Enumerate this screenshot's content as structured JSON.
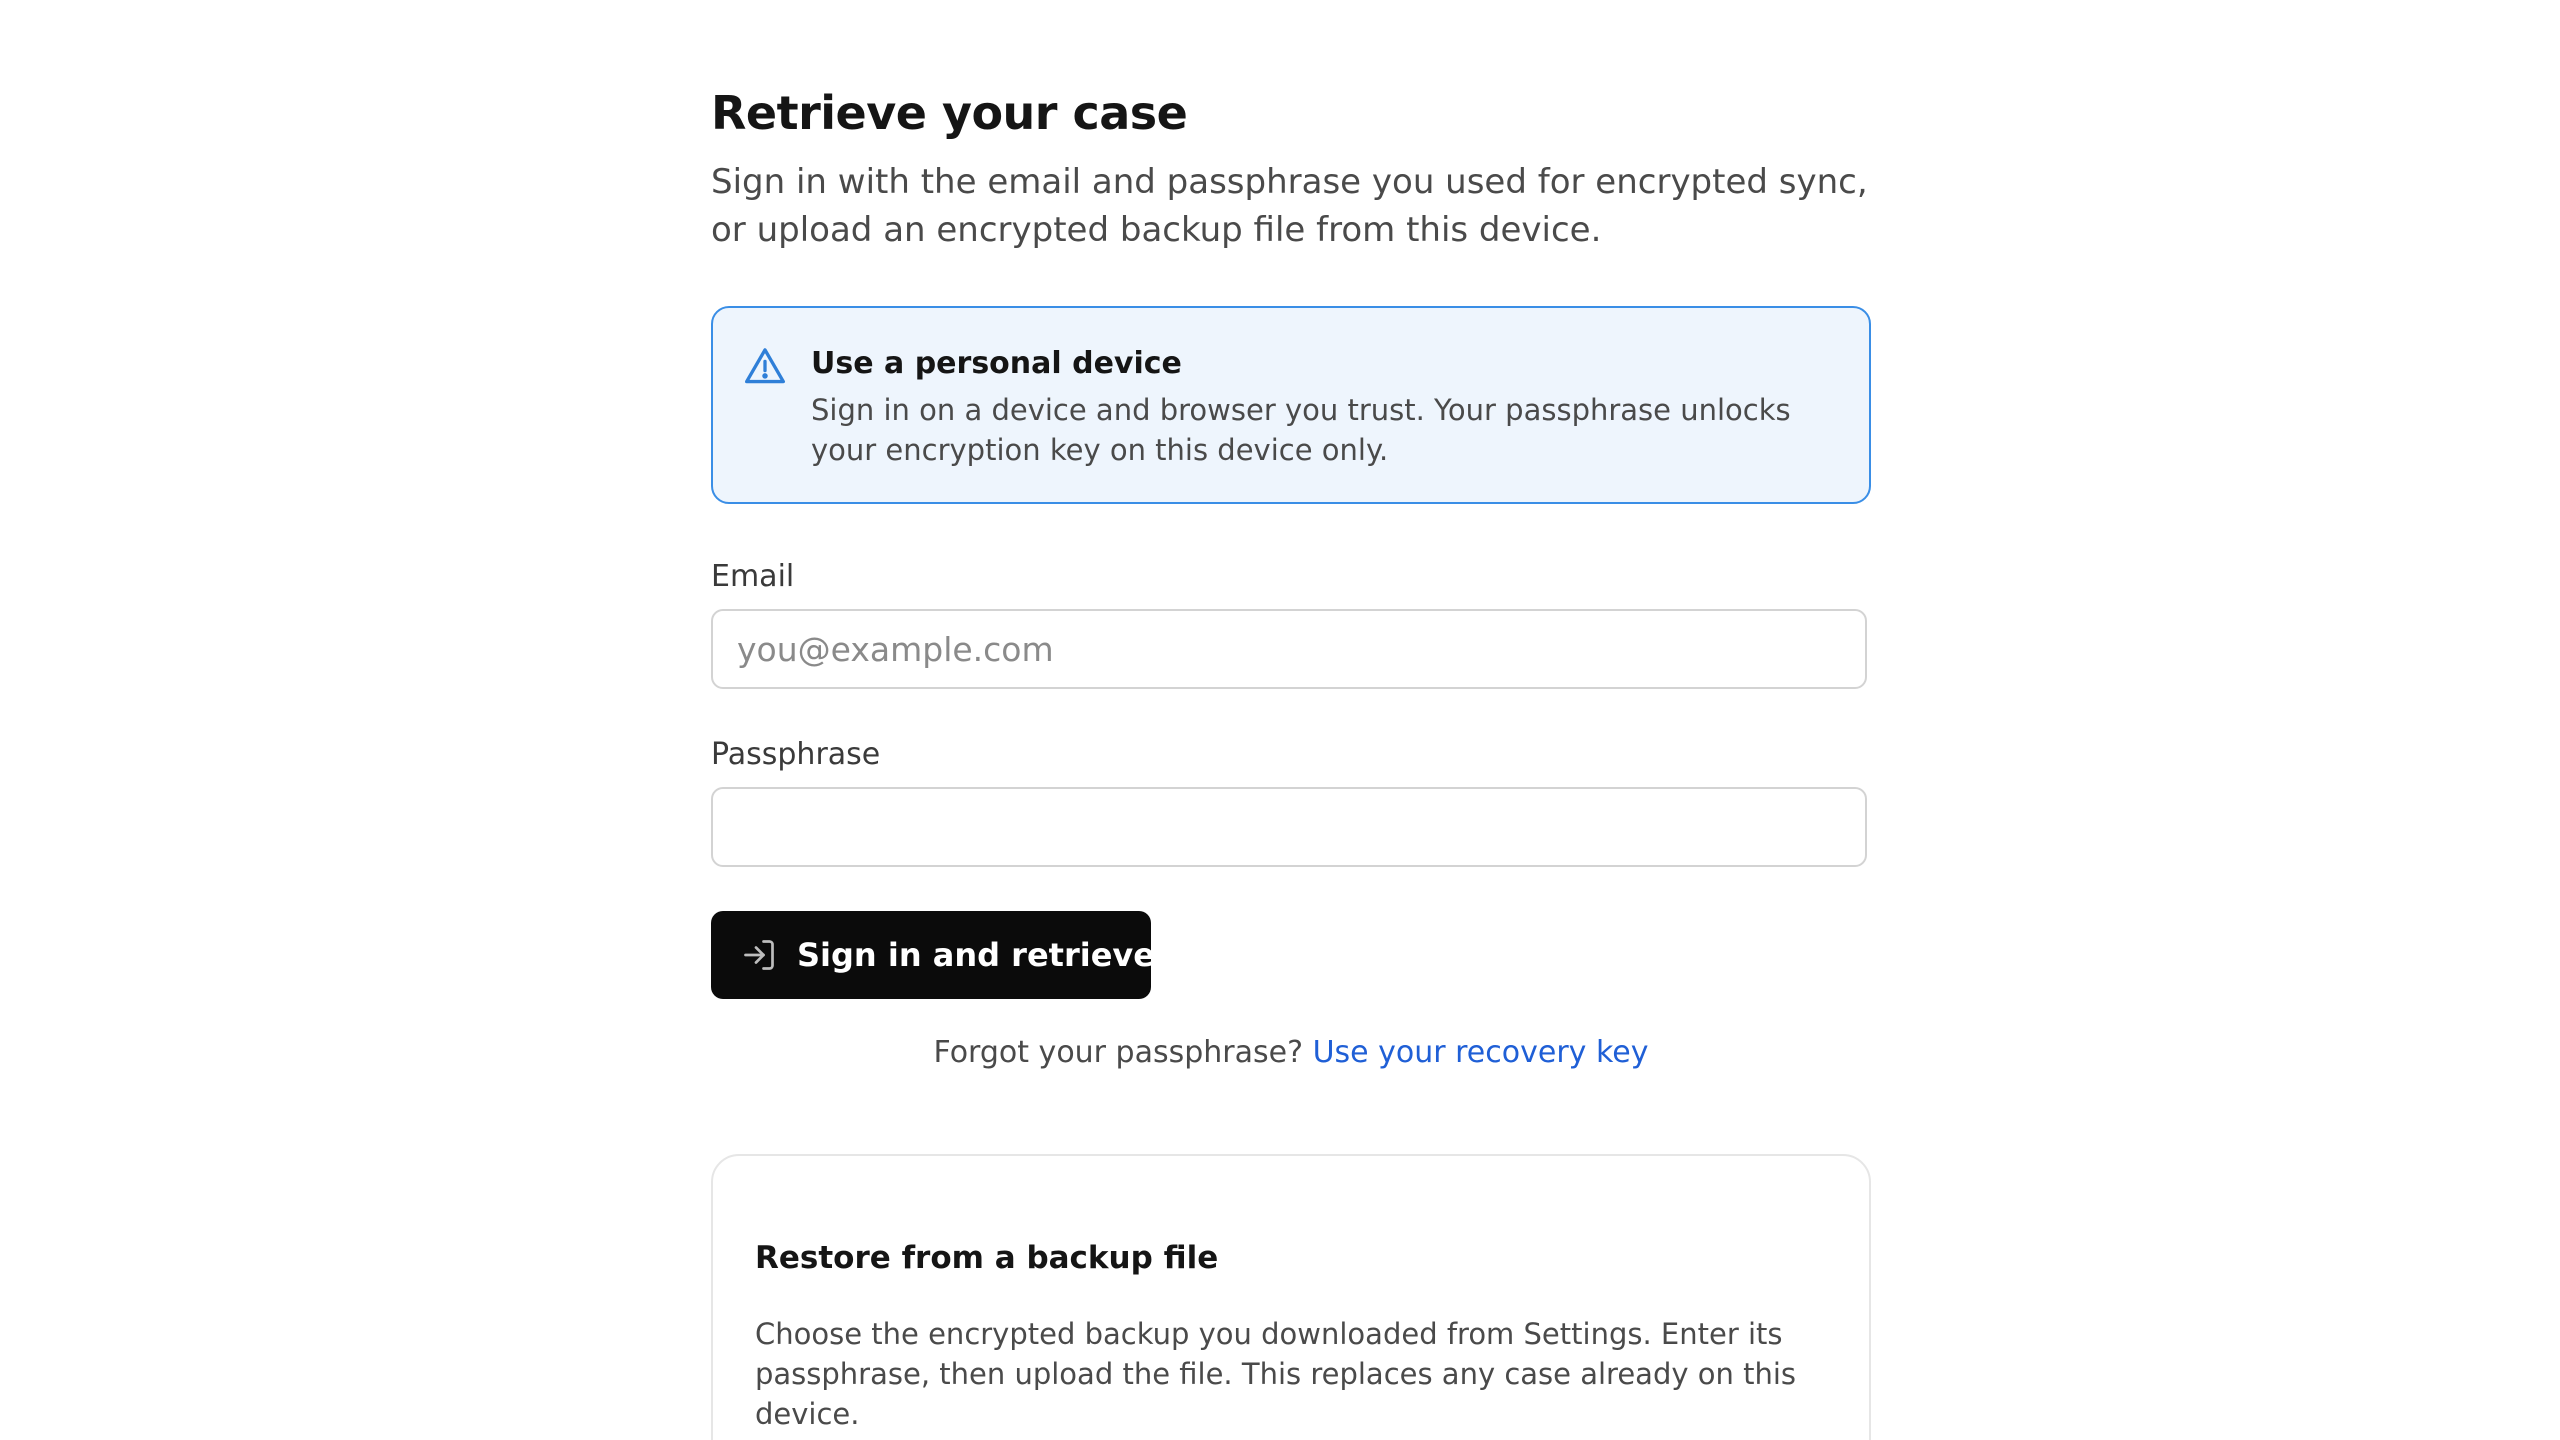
{
  "header": {
    "title": "Retrieve your case",
    "subtitle": "Sign in with the email and passphrase you used for encrypted sync, or upload an encrypted backup file from this device."
  },
  "notice": {
    "icon": "warning-triangle-icon",
    "title": "Use a personal device",
    "text": "Sign in on a device and browser you trust. Your passphrase unlocks your encryption key on this device only."
  },
  "form": {
    "email_label": "Email",
    "email_placeholder": "you@example.com",
    "email_value": "",
    "passphrase_label": "Passphrase",
    "passphrase_value": "",
    "submit_label": "Sign in and retrieve",
    "submit_icon": "sign-in-arrow-icon"
  },
  "recovery": {
    "prompt": "Forgot your passphrase?",
    "link_label": "Use your recovery key"
  },
  "backup": {
    "title": "Restore from a backup file",
    "text": "Choose the encrypted backup you downloaded from Settings. Enter its passphrase, then upload the file. This replaces any case already on this device."
  },
  "colors": {
    "accent": "#3a8ee6",
    "link": "#1f5fd6",
    "notice_bg": "#eef5fd",
    "button_bg": "#0b0b0b"
  }
}
